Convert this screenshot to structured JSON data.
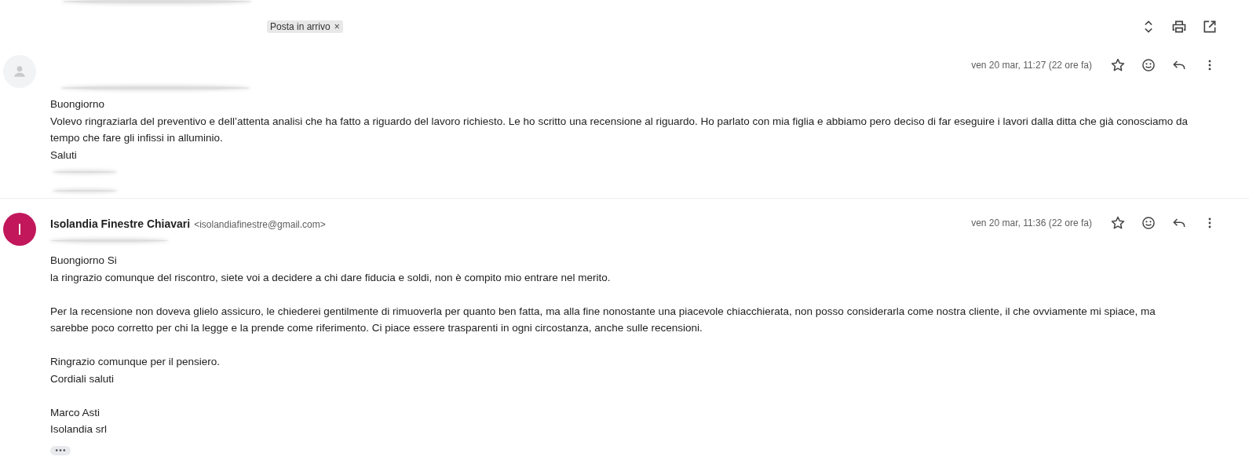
{
  "toolbar": {
    "label": "Posta in arrivo",
    "label_remove": "×"
  },
  "messages": [
    {
      "color": "#f1f3f4",
      "sender_redacted": true,
      "date": "ven 20 mar, 11:27 (22 ore fa)",
      "paragraphs": [
        [
          "Buongiorno",
          "Volevo ringraziarla del preventivo e dell’attenta analisi che ha fatto a riguardo del lavoro richiesto. Le ho scritto una recensione al riguardo. Ho parlato con mia figlia e abbiamo pero deciso di far eseguire i lavori dalla ditta che già conosciamo da tempo che fare gli infissi in alluminio.",
          "Saluti"
        ]
      ],
      "signature_redacted": true,
      "show_trimmed": false
    },
    {
      "avatar_letter": "I",
      "color": "#c2185b",
      "sender_redacted": false,
      "sender_name": "Isolandia Finestre Chiavari",
      "sender_email": "<isolandiafinestre@gmail.com>",
      "date": "ven 20 mar, 11:36 (22 ore fa)",
      "paragraphs": [
        [
          "Buongiorno Si",
          "la ringrazio comunque del riscontro, siete voi a decidere a chi dare fiducia e soldi, non è compito mio entrare nel merito."
        ],
        [
          "Per la recensione non doveva glielo assicuro, le chiederei gentilmente di rimuoverla per quanto ben fatta, ma alla fine nonostante una piacevole chiacchierata, non posso considerarla come nostra cliente, il che ovviamente mi spiace, ma sarebbe poco corretto per chi la legge e la prende come riferimento. Ci piace essere trasparenti in ogni circostanza, anche sulle recensioni."
        ],
        [
          "Ringrazio comunque per il pensiero.",
          "Cordiali saluti"
        ],
        [
          "Marco Asti",
          "Isolandia srl"
        ]
      ],
      "signature_redacted": false,
      "show_trimmed": true
    }
  ]
}
